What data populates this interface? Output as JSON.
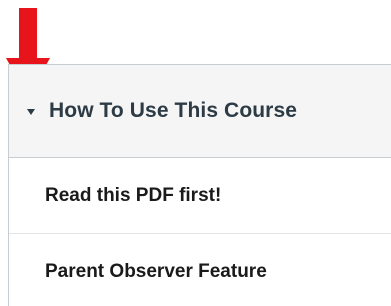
{
  "module": {
    "title": "How To Use This Course",
    "items": [
      {
        "label": "Read this PDF first!"
      },
      {
        "label": "Parent Observer Feature"
      }
    ]
  },
  "annotation": {
    "arrow_color": "#e8141b",
    "arrow_icon": "red-down-arrow-icon"
  },
  "colors": {
    "header_bg": "#f5f5f5",
    "title_text": "#2d3b45",
    "item_text": "#1a1a1a",
    "border": "#c7cdd1"
  }
}
